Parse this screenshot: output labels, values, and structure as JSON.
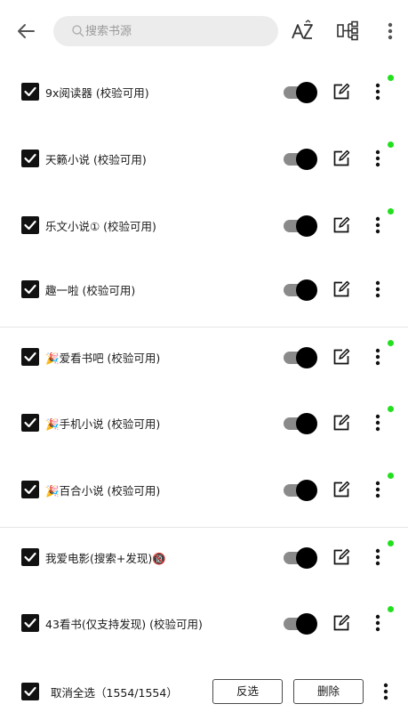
{
  "header": {
    "search_placeholder": "搜索书源",
    "back_icon": "arrow-left-icon",
    "sort_icon": "sort-az-icon",
    "group_icon": "group-icon",
    "menu_icon": "more-vert-icon"
  },
  "sources": [
    {
      "name": "9x阅读器 (校验可用)",
      "checked": true,
      "enabled": true,
      "status_dot": true,
      "emoji": ""
    },
    {
      "name": "天籁小说 (校验可用)",
      "checked": true,
      "enabled": true,
      "status_dot": true,
      "emoji": ""
    },
    {
      "name": "乐文小说① (校验可用)",
      "checked": true,
      "enabled": true,
      "status_dot": true,
      "emoji": ""
    },
    {
      "name": "趣一啦 (校验可用)",
      "checked": true,
      "enabled": true,
      "status_dot": false,
      "emoji": ""
    },
    {
      "name": "爱看书吧 (校验可用)",
      "checked": true,
      "enabled": true,
      "status_dot": true,
      "emoji": "🎉"
    },
    {
      "name": "手机小说 (校验可用)",
      "checked": true,
      "enabled": true,
      "status_dot": true,
      "emoji": "🎉"
    },
    {
      "name": "百合小说 (校验可用)",
      "checked": true,
      "enabled": true,
      "status_dot": true,
      "emoji": "🎉"
    },
    {
      "name": "我爱电影(搜索+发现)",
      "checked": true,
      "enabled": true,
      "status_dot": true,
      "emoji": "",
      "suffix": "🔞"
    },
    {
      "name": "43看书(仅支持发现)  (校验可用)",
      "checked": true,
      "enabled": true,
      "status_dot": true,
      "emoji": ""
    }
  ],
  "bottom": {
    "select_all_label": "取消全选（1554/1554）",
    "invert_label": "反选",
    "delete_label": "删除"
  },
  "colors": {
    "status_dot": "#22e01e",
    "toggle_knob": "#000000",
    "toggle_track": "#8a8a8a"
  }
}
